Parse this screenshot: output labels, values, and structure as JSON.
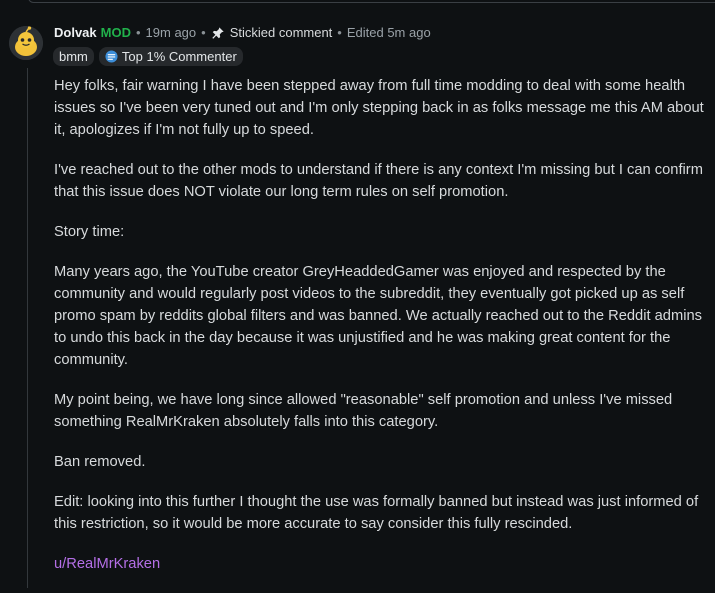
{
  "comment": {
    "author": "Dolvak",
    "mod_label": "MOD",
    "time": "19m ago",
    "stickied_label": "Stickied comment",
    "edited": "Edited 5m ago",
    "badges": [
      {
        "label": "bmm",
        "icon": ""
      },
      {
        "label": "Top 1% Commenter",
        "icon": "top-commenter-icon"
      }
    ],
    "paragraphs": [
      "Hey folks, fair warning I have been stepped away from full time modding to deal with some health issues so I've been very tuned out and I'm only stepping back in as folks message me this AM about it, apologizes if I'm not fully up to speed.",
      "I've reached out to the other mods to understand if there is any context I'm missing but I can confirm that this issue does NOT violate our long term rules on self promotion.",
      "Story time:",
      "Many years ago, the YouTube creator GreyHeaddedGamer was enjoyed and respected by the community and would regularly post videos to the subreddit, they eventually got picked up as self promo spam by reddits global filters and was banned. We actually reached out to the Reddit admins to undo this back in the day because it was unjustified and he was making great content for the community.",
      "My point being, we have long since allowed \"reasonable\" self promotion and unless I've missed something RealMrKraken absolutely falls into this category.",
      "Ban removed.",
      "Edit: looking into this further I thought the use was formally banned but instead was just informed of this restriction, so it would be more accurate to say consider this fully rescinded."
    ],
    "user_link": "u/RealMrKraken"
  },
  "colors": {
    "background": "#0e1113",
    "mod": "#21b14b",
    "link": "#b46fe6",
    "text": "#d7dadc",
    "meta": "#9aa2a8"
  }
}
